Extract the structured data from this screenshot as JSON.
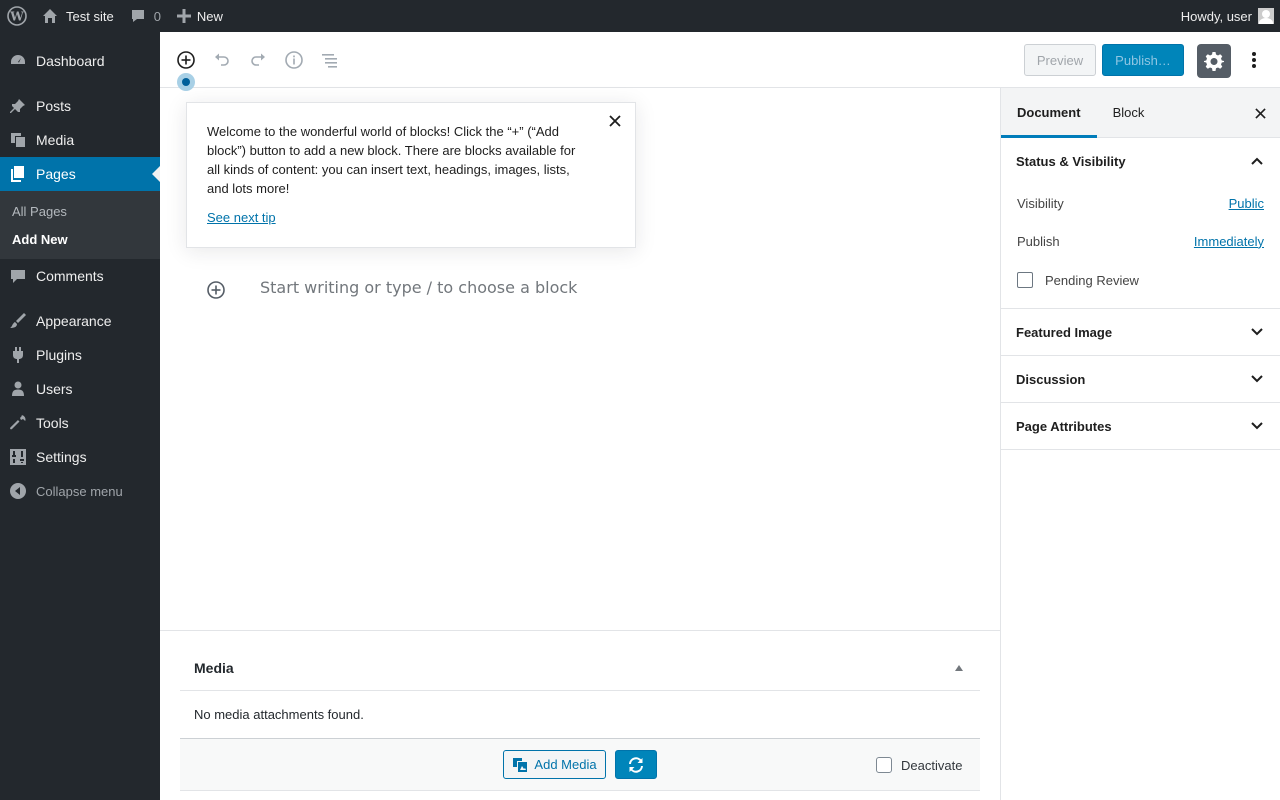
{
  "adminbar": {
    "site_name": "Test site",
    "comments_count": "0",
    "new_label": "New",
    "howdy": "Howdy, user"
  },
  "sidebar": {
    "items": [
      {
        "label": "Dashboard",
        "icon": "dashboard-icon"
      },
      {
        "label": "Posts",
        "icon": "pin-icon"
      },
      {
        "label": "Media",
        "icon": "media-icon"
      },
      {
        "label": "Pages",
        "icon": "pages-icon",
        "current": true
      },
      {
        "label": "Comments",
        "icon": "comment-icon"
      },
      {
        "label": "Appearance",
        "icon": "brush-icon"
      },
      {
        "label": "Plugins",
        "icon": "plugin-icon"
      },
      {
        "label": "Users",
        "icon": "user-icon"
      },
      {
        "label": "Tools",
        "icon": "wrench-icon"
      },
      {
        "label": "Settings",
        "icon": "settings-sliders-icon"
      }
    ],
    "submenu": [
      "All Pages",
      "Add New"
    ],
    "collapse_label": "Collapse menu"
  },
  "header": {
    "preview_label": "Preview",
    "publish_label": "Publish…"
  },
  "tip": {
    "text": "Welcome to the wonderful world of blocks! Click the “+” (“Add block”) button to add a new block. There are blocks available for all kinds of content: you can insert text, headings, images, lists, and lots more!",
    "link": "See next tip"
  },
  "editor": {
    "placeholder": "Start writing or type / to choose a block"
  },
  "settings": {
    "tabs": [
      "Document",
      "Block"
    ],
    "status": {
      "title": "Status & Visibility",
      "visibility_label": "Visibility",
      "visibility_value": "Public",
      "publish_label": "Publish",
      "publish_value": "Immediately",
      "pending_label": "Pending Review"
    },
    "panels": [
      "Featured Image",
      "Discussion",
      "Page Attributes"
    ]
  },
  "metabox": {
    "title": "Media",
    "empty": "No media attachments found.",
    "add_media": "Add Media",
    "deactivate": "Deactivate"
  },
  "colors": {
    "admin_dark": "#23282d",
    "accent": "#0073aa",
    "publish_blue": "#0085ba"
  }
}
